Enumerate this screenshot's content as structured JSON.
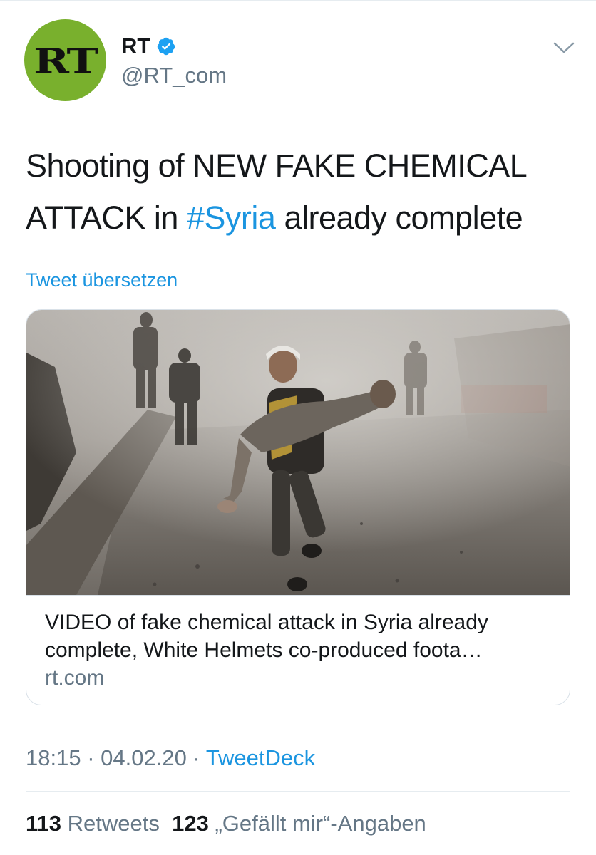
{
  "author": {
    "name": "RT",
    "handle": "@RT_com",
    "avatar_logo": "RT",
    "verified": true,
    "avatar_color": "#79b02d"
  },
  "tweet": {
    "text_part1": "Shooting of NEW FAKE CHEMICAL ATTACK in ",
    "hashtag": "#Syria",
    "text_part2": " already complete",
    "translate_label": "Tweet übersetzen"
  },
  "card": {
    "title_line1": "VIDEO of fake chemical attack in Syria already",
    "title_line2": "complete, White Helmets co-produced foota…",
    "domain": "rt.com"
  },
  "meta": {
    "time": "18:15",
    "separator": " · ",
    "date": "04.02.20",
    "source": "TweetDeck"
  },
  "stats": {
    "retweets_count": "113",
    "retweets_label": "Retweets",
    "likes_count": "123",
    "likes_label": "„Gefällt mir“-Angaben"
  },
  "icons": {
    "verified": "verified-badge-icon",
    "menu": "chevron-down-icon"
  },
  "colors": {
    "link": "#1b95e0",
    "secondary_text": "#657786",
    "primary_text": "#14171a"
  }
}
